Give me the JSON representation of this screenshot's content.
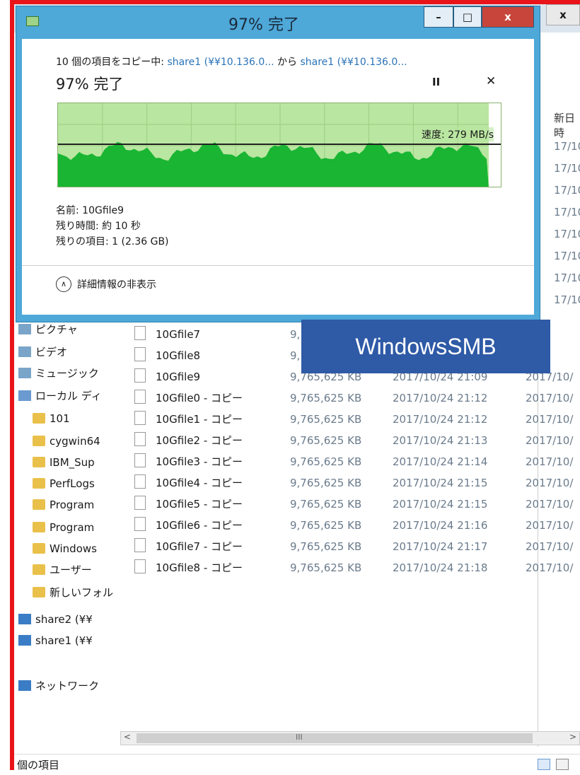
{
  "dialog": {
    "title": "97% 完了",
    "description_prefix": "10 個の項目をコピー中: ",
    "source": "share1 (¥¥10.136.0...",
    "middle": " から ",
    "destination": "share1 (¥¥10.136.0...",
    "progress_text": "97% 完了",
    "progress_percent": 97,
    "speed": "速度: 279 MB/s",
    "name": "名前: 10Gfile9",
    "time_left": "残り時間: 約 10 秒",
    "items_left": "残りの項目: 1 (2.36 GB)",
    "details_toggle": "詳細情報の非表示",
    "pause_icon": "pause-icon",
    "cancel_icon": "close-icon"
  },
  "window_controls": {
    "minimize": "–",
    "maximize": "□",
    "close": "x"
  },
  "explorer": {
    "close_label": "x",
    "search_icon": "search-icon",
    "help_icon": "help-icon",
    "column_header_fragment": "新日時",
    "right_dates": [
      "17/10/",
      "17/10/",
      "17/10/",
      "17/10/",
      "17/10/",
      "17/10/",
      "17/10/",
      "17/10/",
      "17/10/",
      "17/10/",
      "17/10/",
      "17/10/",
      "17/10/",
      "17/10/",
      "17/10/",
      "17/10/",
      "17/10/",
      "17/10/",
      "17/10/",
      "17/10/",
      "17/10/"
    ],
    "sidebar": [
      {
        "label": "ピクチャ",
        "icon": "pictures-icon"
      },
      {
        "label": "ビデオ",
        "icon": "video-icon"
      },
      {
        "label": "ミュージック",
        "icon": "music-icon"
      },
      {
        "label": "ローカル ディ",
        "icon": "drive-icon"
      },
      {
        "label": "101",
        "icon": "folder-icon"
      },
      {
        "label": "cygwin64",
        "icon": "folder-icon"
      },
      {
        "label": "IBM_Sup",
        "icon": "folder-icon"
      },
      {
        "label": "PerfLogs",
        "icon": "folder-icon"
      },
      {
        "label": "Program",
        "icon": "folder-icon"
      },
      {
        "label": "Program",
        "icon": "folder-icon"
      },
      {
        "label": "Windows",
        "icon": "folder-icon"
      },
      {
        "label": "ユーザー",
        "icon": "folder-icon"
      },
      {
        "label": "新しいフォル",
        "icon": "folder-icon"
      },
      {
        "label": "share2 (¥¥",
        "icon": "network-drive-icon"
      },
      {
        "label": "share1 (¥¥",
        "icon": "network-drive-icon"
      },
      {
        "label": "ネットワーク",
        "icon": "network-icon"
      }
    ],
    "files": [
      {
        "name": "10Gfile7",
        "size": "9,",
        "date": "",
        "date2": ""
      },
      {
        "name": "10Gfile8",
        "size": "9,",
        "date": "",
        "date2": ""
      },
      {
        "name": "10Gfile9",
        "size": "9,765,625 KB",
        "date": "2017/10/24 21:09",
        "date2": "2017/10/"
      },
      {
        "name": "10Gfile0 - コピー",
        "size": "9,765,625 KB",
        "date": "2017/10/24 21:12",
        "date2": "2017/10/"
      },
      {
        "name": "10Gfile1 - コピー",
        "size": "9,765,625 KB",
        "date": "2017/10/24 21:12",
        "date2": "2017/10/"
      },
      {
        "name": "10Gfile2 - コピー",
        "size": "9,765,625 KB",
        "date": "2017/10/24 21:13",
        "date2": "2017/10/"
      },
      {
        "name": "10Gfile3 - コピー",
        "size": "9,765,625 KB",
        "date": "2017/10/24 21:14",
        "date2": "2017/10/"
      },
      {
        "name": "10Gfile4 - コピー",
        "size": "9,765,625 KB",
        "date": "2017/10/24 21:15",
        "date2": "2017/10/"
      },
      {
        "name": "10Gfile5 - コピー",
        "size": "9,765,625 KB",
        "date": "2017/10/24 21:15",
        "date2": "2017/10/"
      },
      {
        "name": "10Gfile6 - コピー",
        "size": "9,765,625 KB",
        "date": "2017/10/24 21:16",
        "date2": "2017/10/"
      },
      {
        "name": "10Gfile7 - コピー",
        "size": "9,765,625 KB",
        "date": "2017/10/24 21:17",
        "date2": "2017/10/"
      },
      {
        "name": "10Gfile8 - コピー",
        "size": "9,765,625 KB",
        "date": "2017/10/24 21:18",
        "date2": "2017/10/"
      }
    ],
    "status_text": "個の項目",
    "scroll_grip": "III",
    "scroll_left": "<",
    "scroll_right": ">"
  },
  "overlay_label": "WindowsSMB",
  "colors": {
    "frame": "#e8141a",
    "dialog_border": "#4ea8d8",
    "graph_fill": "#19b533",
    "graph_bg": "#b9e6a0",
    "label_bg": "#2e5aa6",
    "link": "#2a73b8"
  }
}
